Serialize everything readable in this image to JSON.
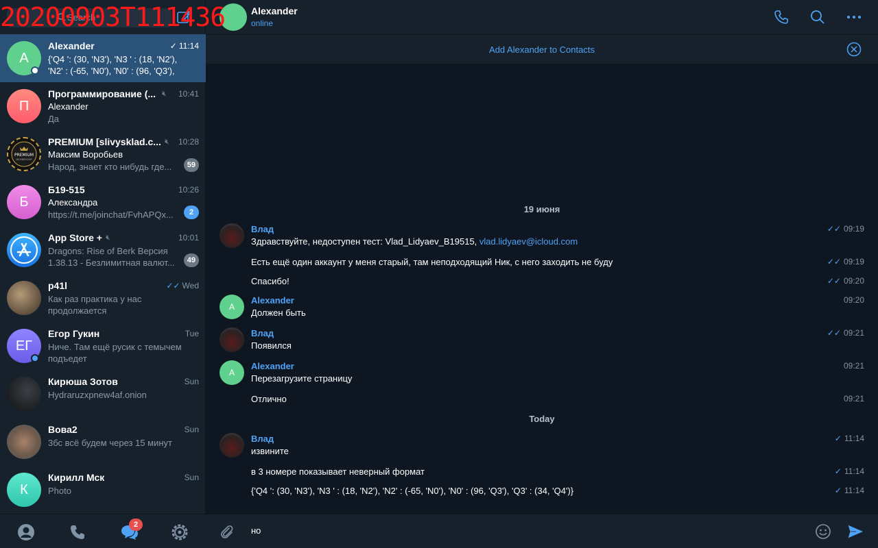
{
  "watermark": "20200903T111436",
  "search": {
    "placeholder": "Search"
  },
  "chats": [
    {
      "name": "Alexander",
      "time": "11:14",
      "check": "✓",
      "line1": "{'Q4 ': (30, 'N3'), 'N3 ' : (18, 'N2'),",
      "line2": "'N2' : (-65, 'N0'), 'N0' : (96, 'Q3'),",
      "initial": "A",
      "color": "#5fd08d"
    },
    {
      "name": "Программирование (...",
      "time": "10:41",
      "sender": "Alexander",
      "preview": "Да",
      "initial": "П",
      "color": "#ff6b6b"
    },
    {
      "name": "PREMIUM [slivysklad.c...",
      "time": "10:28",
      "sender": "Максим Воробьев",
      "preview": "Народ, знает кто нибудь где...",
      "badge": "59",
      "logo_text": "PREMIUM"
    },
    {
      "name": "Б19-515",
      "time": "10:26",
      "sender": "Александра",
      "preview": "https://t.me/joinchat/FvhAPQx...",
      "badge": "2",
      "initial": "Б",
      "color": "#e36bd9"
    },
    {
      "name": "App Store +",
      "time": "10:01",
      "line1": "Dragons: Rise of Berk Версия",
      "line2": "1.38.13  - Безлимитная валют...",
      "badge": "49"
    },
    {
      "name": "p41l",
      "time": "Wed",
      "check": "✓✓",
      "preview": "Как раз практика у нас продолжается"
    },
    {
      "name": "Егор Гукин",
      "time": "Tue",
      "preview": "Ниче. Там ещё русик с темычем подъедет",
      "initial": "ЕГ",
      "color": "#7b6cf0"
    },
    {
      "name": "Кирюша Зотов",
      "time": "Sun",
      "preview": "Hydraruzxpnew4af.onion"
    },
    {
      "name": "Вова2",
      "time": "Sun",
      "preview": "3бс всё будем через 15 минут"
    },
    {
      "name": "Кирилл Мск",
      "time": "Sun",
      "preview": "Photo",
      "initial": "К",
      "color": "#38d3b8"
    }
  ],
  "tabs": {
    "chats_badge": "2"
  },
  "header": {
    "name": "Alexander",
    "status": "online"
  },
  "banner": {
    "text": "Add Alexander to Contacts"
  },
  "dates": {
    "first": "19 июня",
    "second": "Today"
  },
  "messages": [
    {
      "sender": "Влад",
      "text": "Здравствуйте, недоступен тест: Vlad_Lidyaev_B19515, ",
      "link": "vlad.lidyaev@icloud.com",
      "time": "09:19",
      "tick": "✓✓"
    },
    {
      "text": "Есть ещё один аккаунт у меня старый, там неподходящий Ник, с него заходить не буду",
      "time": "09:19",
      "tick": "✓✓"
    },
    {
      "text": "Спасибо!",
      "time": "09:20",
      "tick": "✓✓"
    },
    {
      "sender": "Alexander",
      "text": "Должен быть",
      "time": "09:20",
      "avatar": "A"
    },
    {
      "sender": "Влад",
      "text": "Появился",
      "time": "09:21",
      "tick": "✓✓"
    },
    {
      "sender": "Alexander",
      "text": "Перезагрузите страницу",
      "time": "09:21",
      "avatar": "A"
    },
    {
      "text": "Отлично",
      "time": "09:21"
    },
    {
      "sender": "Влад",
      "text": "извините",
      "time": "11:14",
      "tick": "✓"
    },
    {
      "text": "в 3 номере показывает неверный формат",
      "time": "11:14",
      "tick": "✓"
    },
    {
      "text": "{'Q4 ': (30, 'N3'), 'N3 ' : (18, 'N2'), 'N2' : (-65, 'N0'), 'N0' : (96, 'Q3'), 'Q3' : (34, 'Q4')}",
      "time": "11:14",
      "tick": "✓"
    }
  ],
  "composer": {
    "value": "но"
  },
  "colors": {
    "accent": "#4fa3f7",
    "sidebar_bg": "#17212b",
    "chat_bg": "#0e1621",
    "active": "#2b5278"
  }
}
